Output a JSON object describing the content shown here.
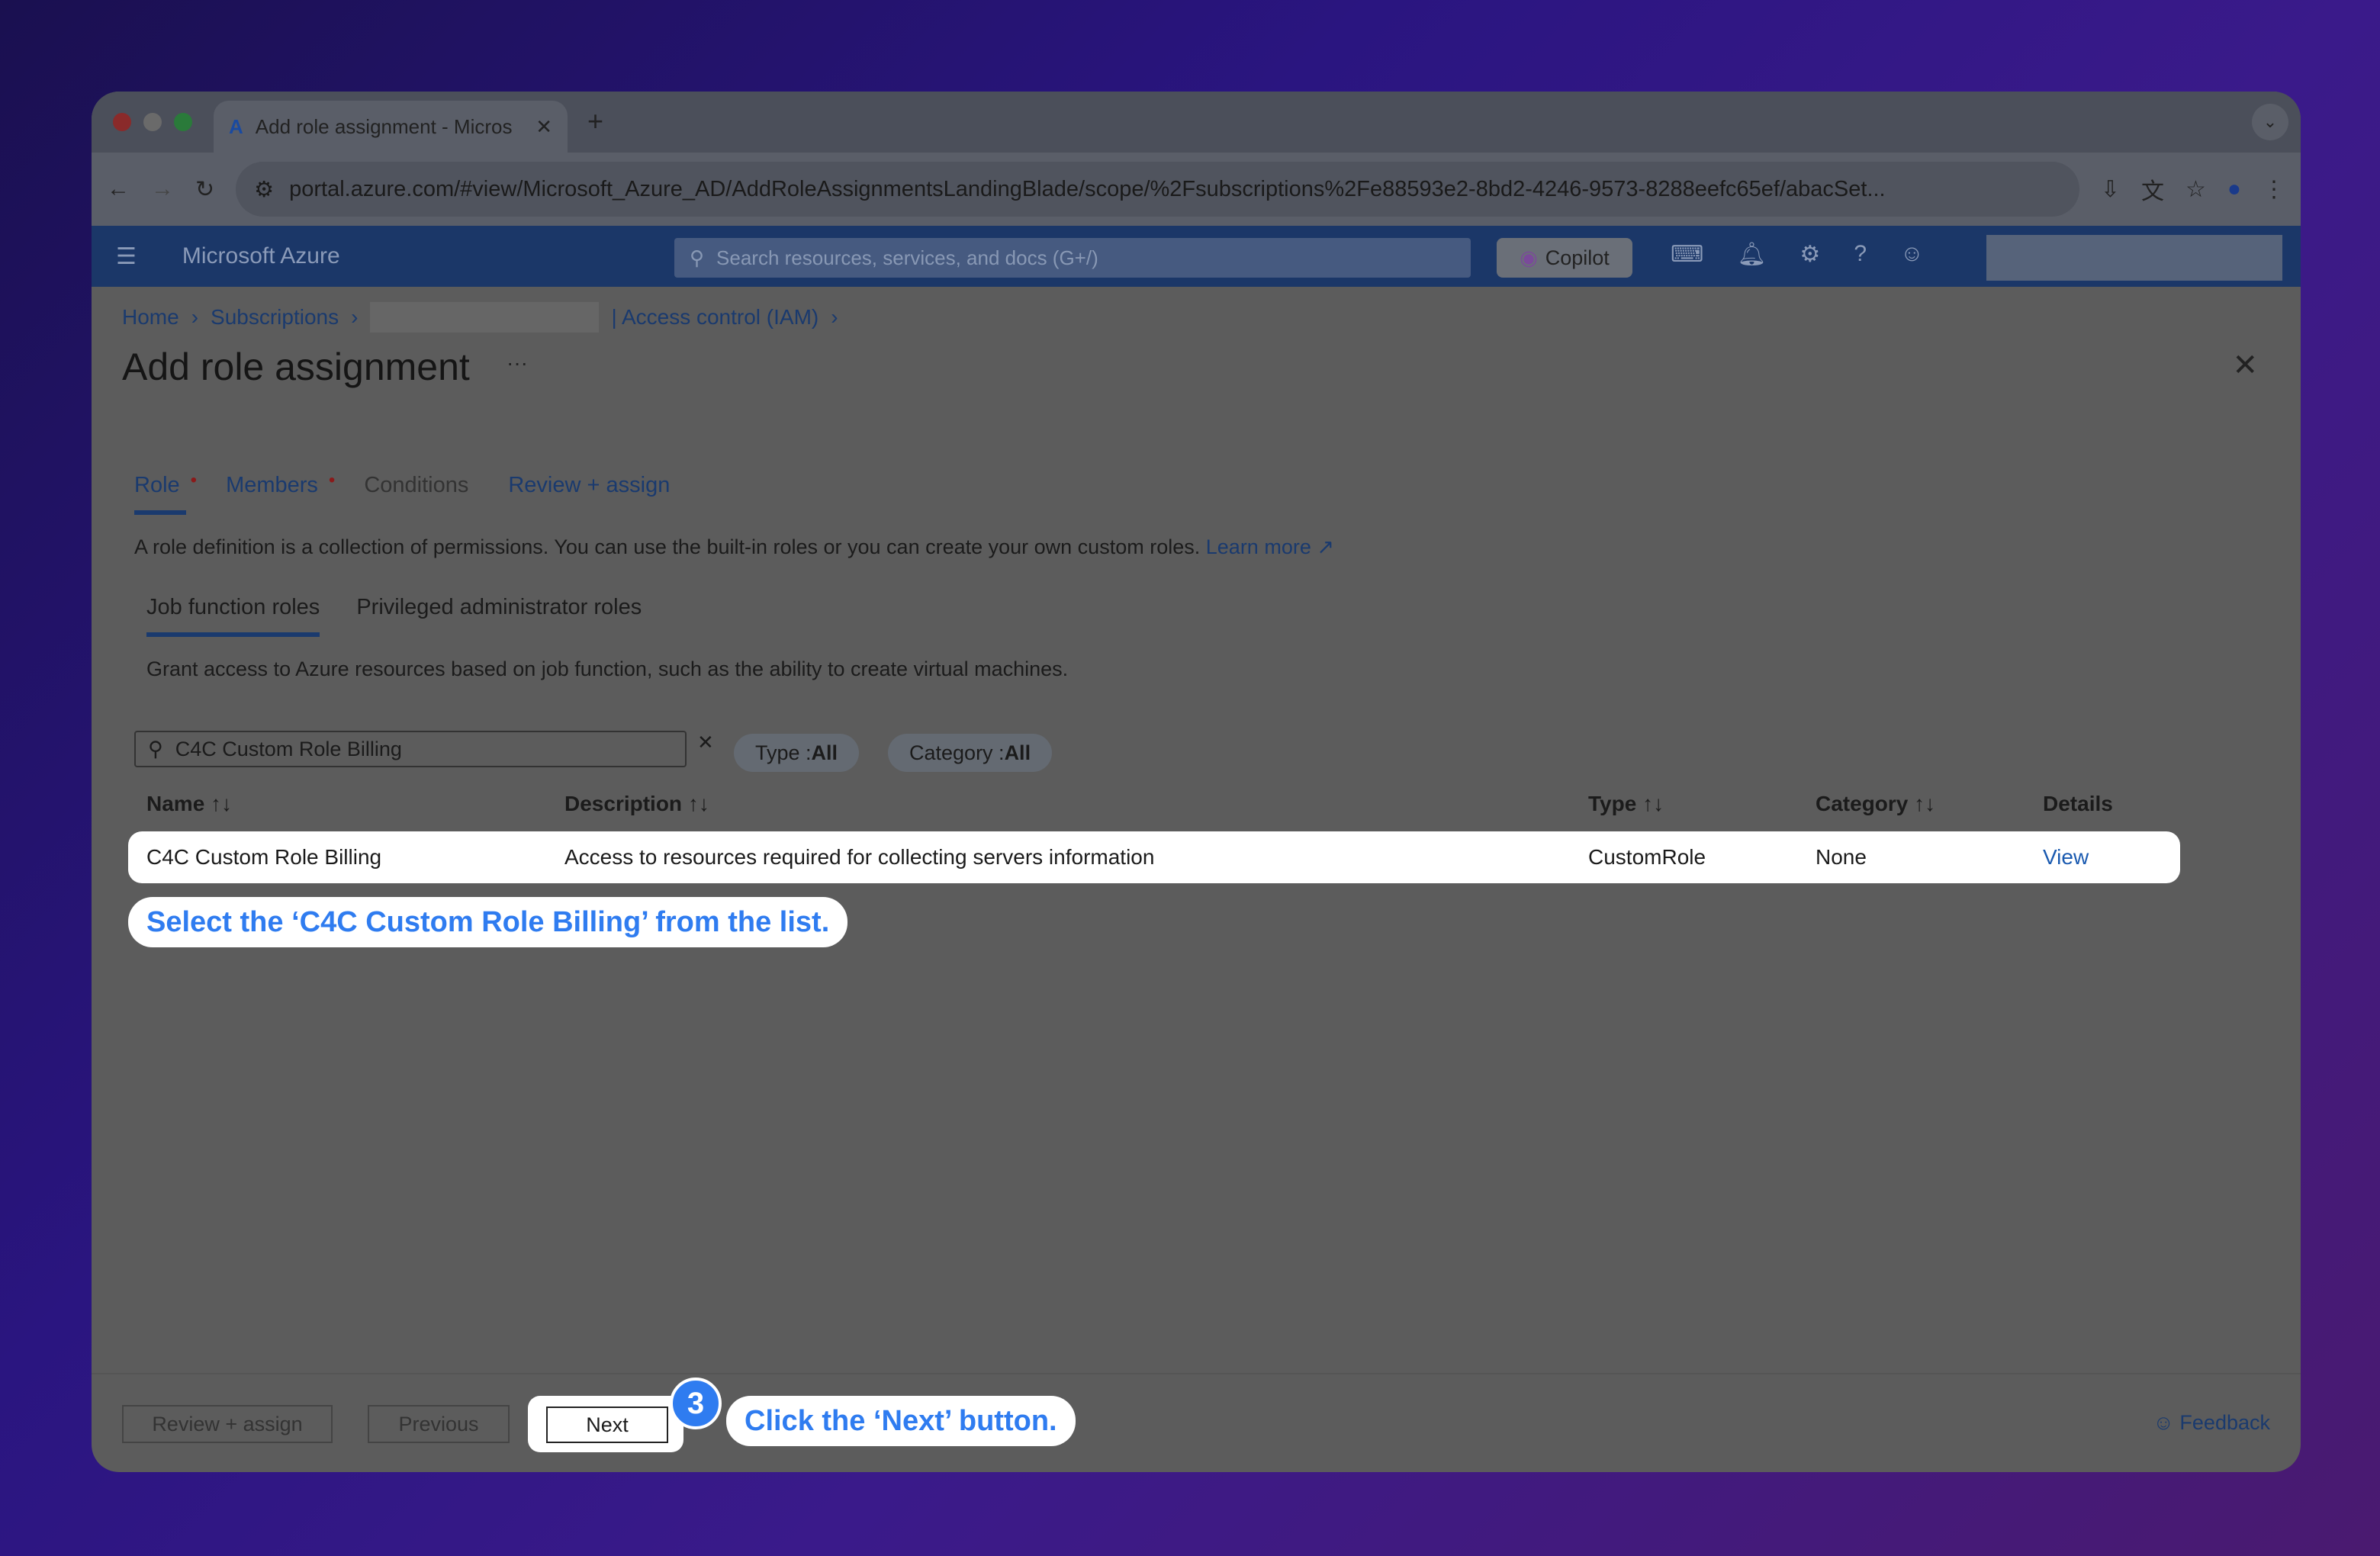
{
  "browser": {
    "tab_title": "Add role assignment - Micros",
    "url": "portal.azure.com/#view/Microsoft_Azure_AD/AddRoleAssignmentsLandingBlade/scope/%2Fsubscriptions%2Fe88593e2-8bd2-4246-9573-8288eefc65ef/abacSet..."
  },
  "azure": {
    "brand": "Microsoft Azure",
    "search_placeholder": "Search resources, services, and docs (G+/)",
    "copilot": "Copilot"
  },
  "breadcrumb": {
    "home": "Home",
    "subscriptions": "Subscriptions",
    "iam": "| Access control (IAM)"
  },
  "page": {
    "title": "Add role assignment",
    "more": "···"
  },
  "tabs": [
    {
      "label": "Role"
    },
    {
      "label": "Members"
    },
    {
      "label": "Conditions"
    },
    {
      "label": "Review + assign"
    }
  ],
  "description": "A role definition is a collection of permissions. You can use the built-in roles or you can create your own custom roles.",
  "learn_more": "Learn more",
  "subtabs": [
    {
      "label": "Job function roles"
    },
    {
      "label": "Privileged administrator roles"
    }
  ],
  "grant_text": "Grant access to Azure resources based on job function, such as the ability to create virtual machines.",
  "filter": {
    "value": "C4C Custom Role Billing",
    "type_label": "Type : ",
    "type_value": "All",
    "category_label": "Category : ",
    "category_value": "All"
  },
  "table": {
    "headers": [
      "Name",
      "Description",
      "Type",
      "Category",
      "Details"
    ],
    "sort": "↑↓",
    "rows": [
      {
        "name": "C4C Custom Role Billing",
        "description": "Access to resources required for collecting servers information",
        "type": "CustomRole",
        "category": "None",
        "details": "View"
      }
    ]
  },
  "hints": {
    "select": "Select the ‘C4C Custom Role Billing’ from the list.",
    "next": "Click the ‘Next’ button.",
    "step": "3"
  },
  "footer": {
    "review": "Review + assign",
    "previous": "Previous",
    "next": "Next",
    "feedback": "Feedback"
  },
  "colors": {
    "accent": "#2f7cf0",
    "azure_bar": "#1b3768"
  }
}
